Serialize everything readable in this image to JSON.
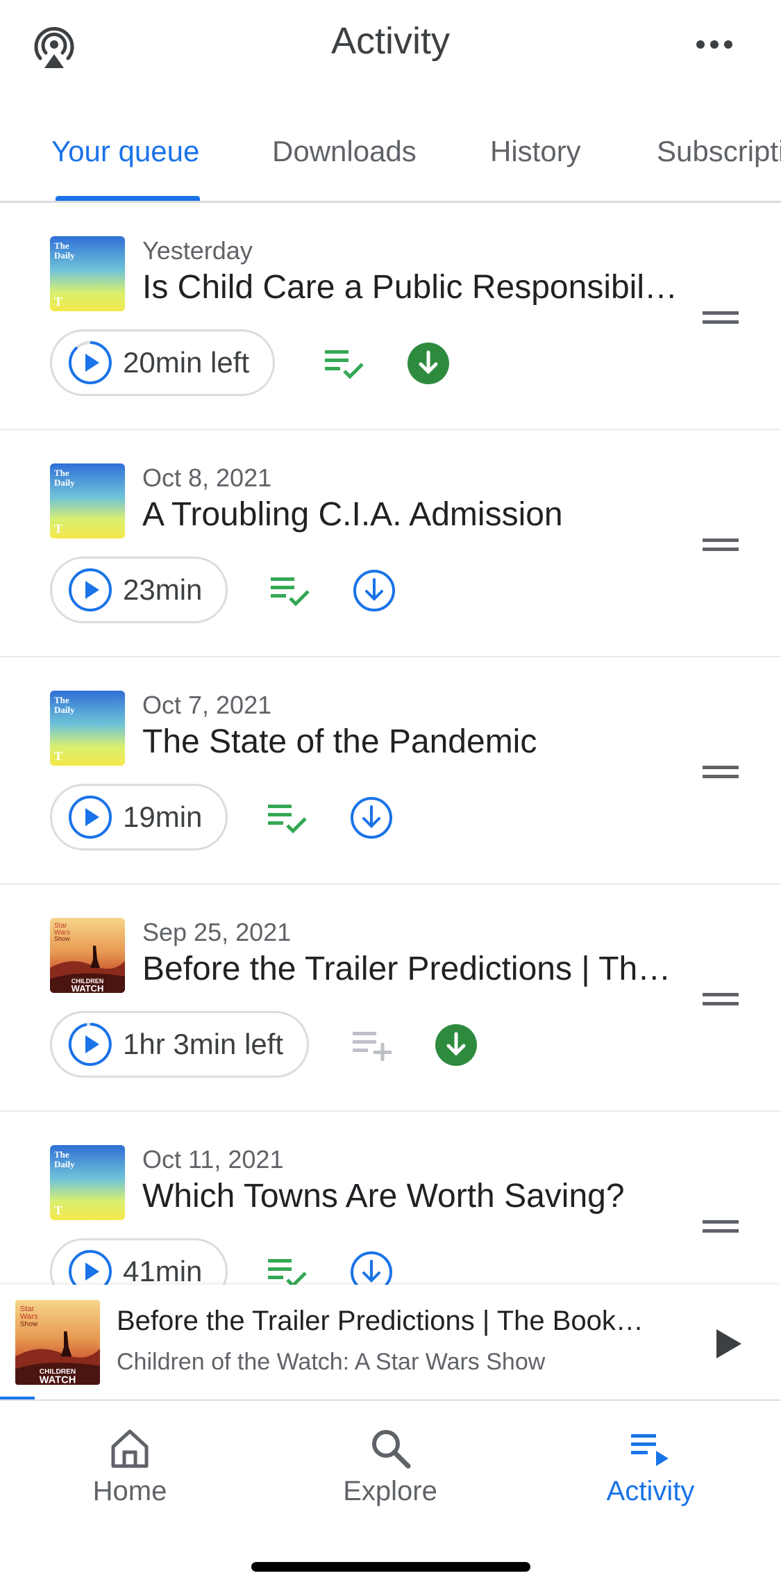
{
  "header": {
    "title": "Activity",
    "cast_icon": "podcast-cast-icon",
    "more_icon": "more-horizontal-icon"
  },
  "tabs": [
    {
      "label": "Your queue",
      "active": true
    },
    {
      "label": "Downloads",
      "active": false
    },
    {
      "label": "History",
      "active": false
    },
    {
      "label": "Subscriptions",
      "active": false
    }
  ],
  "queue": [
    {
      "date": "Yesterday",
      "title": "Is Child Care a Public Responsibility?",
      "duration": "20min left",
      "in_queue": true,
      "downloaded": true,
      "podcast": "The Daily"
    },
    {
      "date": "Oct 8, 2021",
      "title": "A Troubling C.I.A. Admission",
      "duration": "23min",
      "in_queue": true,
      "downloaded": false,
      "podcast": "The Daily"
    },
    {
      "date": "Oct 7, 2021",
      "title": "The State of the Pandemic",
      "duration": "19min",
      "in_queue": true,
      "downloaded": false,
      "podcast": "The Daily"
    },
    {
      "date": "Sep 25, 2021",
      "title": "Before the Trailer Predictions | The Book of Boba Fett",
      "duration": "1hr 3min left",
      "in_queue": false,
      "downloaded": true,
      "podcast": "Children of the Watch"
    },
    {
      "date": "Oct 11, 2021",
      "title": "Which Towns Are Worth Saving?",
      "duration": "41min",
      "in_queue": true,
      "downloaded": false,
      "podcast": "The Daily"
    }
  ],
  "now_playing": {
    "title": "Before the Trailer Predictions | The Book of Boba Fett",
    "subtitle": "Children of the Watch: A Star Wars Show",
    "progress": 0.04
  },
  "bottom_nav": [
    {
      "label": "Home",
      "icon": "home-icon",
      "active": false
    },
    {
      "label": "Explore",
      "icon": "search-icon",
      "active": false
    },
    {
      "label": "Activity",
      "icon": "playlist-play-icon",
      "active": true
    }
  ],
  "colors": {
    "accent": "#1a73e8",
    "green": "#34a853",
    "download_green": "#2e8b3e",
    "text": "#202124",
    "secondary": "#5f6368"
  }
}
